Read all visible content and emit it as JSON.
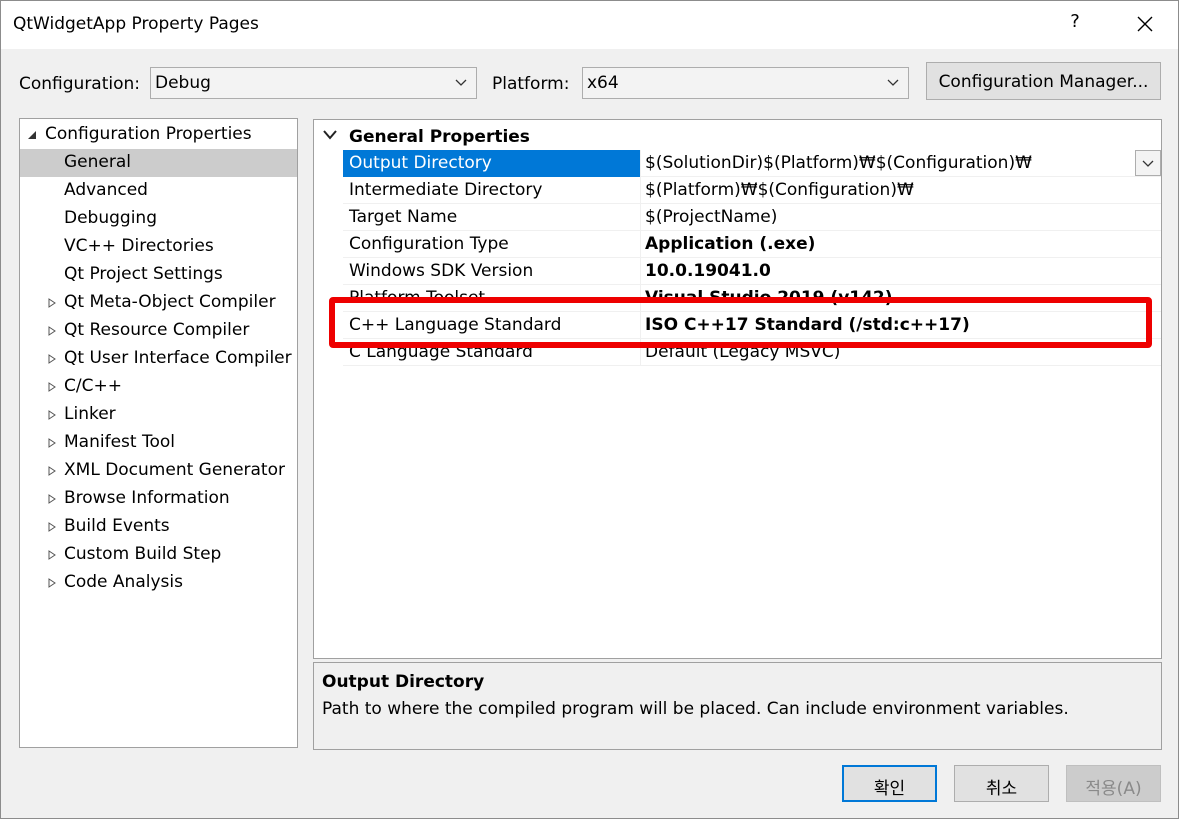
{
  "window": {
    "title": "QtWidgetApp Property Pages",
    "help": "?"
  },
  "config": {
    "configuration_label": "Configuration:",
    "configuration_value": "Debug",
    "platform_label": "Platform:",
    "platform_value": "x64",
    "manager_button": "Configuration Manager..."
  },
  "tree": {
    "root": "Configuration Properties",
    "items": [
      {
        "label": "General",
        "expandable": false,
        "selected": true
      },
      {
        "label": "Advanced",
        "expandable": false
      },
      {
        "label": "Debugging",
        "expandable": false
      },
      {
        "label": "VC++ Directories",
        "expandable": false
      },
      {
        "label": "Qt Project Settings",
        "expandable": false
      },
      {
        "label": "Qt Meta-Object Compiler",
        "expandable": true
      },
      {
        "label": "Qt Resource Compiler",
        "expandable": true
      },
      {
        "label": "Qt User Interface Compiler",
        "expandable": true
      },
      {
        "label": "C/C++",
        "expandable": true
      },
      {
        "label": "Linker",
        "expandable": true
      },
      {
        "label": "Manifest Tool",
        "expandable": true
      },
      {
        "label": "XML Document Generator",
        "expandable": true
      },
      {
        "label": "Browse Information",
        "expandable": true
      },
      {
        "label": "Build Events",
        "expandable": true
      },
      {
        "label": "Custom Build Step",
        "expandable": true
      },
      {
        "label": "Code Analysis",
        "expandable": true
      }
    ]
  },
  "grid": {
    "section": "General Properties",
    "rows": [
      {
        "name": "Output Directory",
        "value": "$(SolutionDir)$(Platform)₩$(Configuration)₩",
        "bold": false,
        "selected": true
      },
      {
        "name": "Intermediate Directory",
        "value": "$(Platform)₩$(Configuration)₩",
        "bold": false
      },
      {
        "name": "Target Name",
        "value": "$(ProjectName)",
        "bold": false
      },
      {
        "name": "Configuration Type",
        "value": "Application (.exe)",
        "bold": true
      },
      {
        "name": "Windows SDK Version",
        "value": "10.0.19041.0",
        "bold": true
      },
      {
        "name": "Platform Toolset",
        "value": "Visual Studio 2019 (v142)",
        "bold": true
      },
      {
        "name": "C++ Language Standard",
        "value": "ISO C++17 Standard (/std:c++17)",
        "bold": true
      },
      {
        "name": "C Language Standard",
        "value": "Default (Legacy MSVC)",
        "bold": false
      }
    ]
  },
  "description": {
    "title": "Output Directory",
    "text": "Path to where the compiled program will be placed. Can include environment variables."
  },
  "buttons": {
    "ok": "확인",
    "cancel": "취소",
    "apply": "적용(A)"
  },
  "colors": {
    "selection": "#0078d7",
    "highlight": "#ee0000"
  }
}
